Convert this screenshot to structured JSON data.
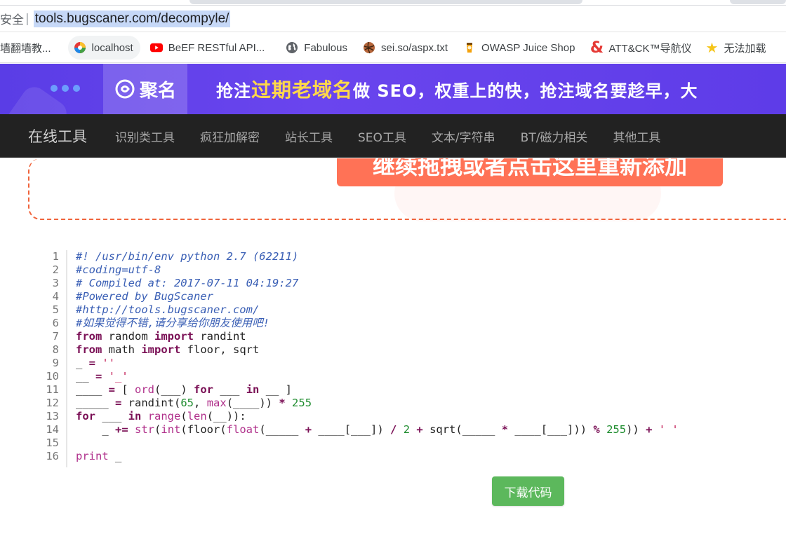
{
  "browser": {
    "security_label": "安全",
    "url": "tools.bugscaner.com/decompyle/"
  },
  "bookmarks": [
    {
      "label": "墙翻墙教...",
      "icon": "folder-icon"
    },
    {
      "label": "localhost",
      "icon": "chrome-pinwheel-icon"
    },
    {
      "label": "BeEF RESTful API...",
      "icon": "youtube-icon"
    },
    {
      "label": "Fabulous",
      "icon": "globe-icon"
    },
    {
      "label": "sei.so/aspx.txt",
      "icon": "ball-icon"
    },
    {
      "label": "OWASP Juice Shop",
      "icon": "juice-icon"
    },
    {
      "label": "ATT&CK™导航仪",
      "icon": "ampersand-icon"
    },
    {
      "label": "无法加载",
      "icon": "star-icon"
    }
  ],
  "banner": {
    "logo_text": "聚名",
    "slogan_prefix": "抢注",
    "slogan_highlight": "过期老域名",
    "slogan_suffix": "做 SEO，权重上的快，抢注域名要趁早，大"
  },
  "nav": {
    "brand": "在线工具",
    "items": [
      "识别类工具",
      "疯狂加解密",
      "站长工具",
      "SEO工具",
      "文本/字符串",
      "BT/磁力相关",
      "其他工具"
    ]
  },
  "upload": {
    "button_text": "继续拖拽或者点击这里重新添加"
  },
  "code": {
    "line_numbers": [
      "1",
      "2",
      "3",
      "4",
      "5",
      "6",
      "7",
      "8",
      "9",
      "10",
      "11",
      "12",
      "13",
      "14",
      "15",
      "16"
    ],
    "lines": [
      [
        {
          "t": "#! /usr/bin/env python 2.7 (62211)",
          "c": "com"
        }
      ],
      [
        {
          "t": "#coding=utf-8",
          "c": "com"
        }
      ],
      [
        {
          "t": "# Compiled at: 2017-07-11 04:19:27",
          "c": "com"
        }
      ],
      [
        {
          "t": "#Powered by BugScaner",
          "c": "com"
        }
      ],
      [
        {
          "t": "#http://tools.bugscaner.com/",
          "c": "com"
        }
      ],
      [
        {
          "t": "#如果觉得不错,请分享给你朋友使用吧!",
          "c": "com"
        }
      ],
      [
        {
          "t": "from",
          "c": "kw"
        },
        {
          "t": " random ",
          "c": "plain"
        },
        {
          "t": "import",
          "c": "kw"
        },
        {
          "t": " randint",
          "c": "plain"
        }
      ],
      [
        {
          "t": "from",
          "c": "kw"
        },
        {
          "t": " math ",
          "c": "plain"
        },
        {
          "t": "import",
          "c": "kw"
        },
        {
          "t": " floor, sqrt",
          "c": "plain"
        }
      ],
      [
        {
          "t": "_ ",
          "c": "plain"
        },
        {
          "t": "=",
          "c": "op"
        },
        {
          "t": " ",
          "c": "plain"
        },
        {
          "t": "''",
          "c": "str"
        }
      ],
      [
        {
          "t": "__ ",
          "c": "plain"
        },
        {
          "t": "=",
          "c": "op"
        },
        {
          "t": " ",
          "c": "plain"
        },
        {
          "t": "'_'",
          "c": "str"
        }
      ],
      [
        {
          "t": "____ ",
          "c": "plain"
        },
        {
          "t": "=",
          "c": "op"
        },
        {
          "t": " [ ",
          "c": "plain"
        },
        {
          "t": "ord",
          "c": "bi"
        },
        {
          "t": "(___) ",
          "c": "plain"
        },
        {
          "t": "for",
          "c": "kw"
        },
        {
          "t": " ___ ",
          "c": "plain"
        },
        {
          "t": "in",
          "c": "kw"
        },
        {
          "t": " __ ]",
          "c": "plain"
        }
      ],
      [
        {
          "t": "_____ ",
          "c": "plain"
        },
        {
          "t": "=",
          "c": "op"
        },
        {
          "t": " randint(",
          "c": "plain"
        },
        {
          "t": "65",
          "c": "num"
        },
        {
          "t": ", ",
          "c": "plain"
        },
        {
          "t": "max",
          "c": "bi"
        },
        {
          "t": "(____)) ",
          "c": "plain"
        },
        {
          "t": "*",
          "c": "op"
        },
        {
          "t": " ",
          "c": "plain"
        },
        {
          "t": "255",
          "c": "num"
        }
      ],
      [
        {
          "t": "for",
          "c": "kw"
        },
        {
          "t": " ___ ",
          "c": "plain"
        },
        {
          "t": "in",
          "c": "kw"
        },
        {
          "t": " ",
          "c": "plain"
        },
        {
          "t": "range",
          "c": "bi"
        },
        {
          "t": "(",
          "c": "plain"
        },
        {
          "t": "len",
          "c": "bi"
        },
        {
          "t": "(__)):",
          "c": "plain"
        }
      ],
      [
        {
          "t": "    _ ",
          "c": "plain"
        },
        {
          "t": "+=",
          "c": "op"
        },
        {
          "t": " ",
          "c": "plain"
        },
        {
          "t": "str",
          "c": "bi"
        },
        {
          "t": "(",
          "c": "plain"
        },
        {
          "t": "int",
          "c": "bi"
        },
        {
          "t": "(floor(",
          "c": "plain"
        },
        {
          "t": "float",
          "c": "bi"
        },
        {
          "t": "(_____ ",
          "c": "plain"
        },
        {
          "t": "+",
          "c": "op"
        },
        {
          "t": " ____[___]) ",
          "c": "plain"
        },
        {
          "t": "/",
          "c": "op"
        },
        {
          "t": " ",
          "c": "plain"
        },
        {
          "t": "2",
          "c": "num"
        },
        {
          "t": " ",
          "c": "plain"
        },
        {
          "t": "+",
          "c": "op"
        },
        {
          "t": " sqrt(_____ ",
          "c": "plain"
        },
        {
          "t": "*",
          "c": "op"
        },
        {
          "t": " ____[___])) ",
          "c": "plain"
        },
        {
          "t": "%",
          "c": "op"
        },
        {
          "t": " ",
          "c": "plain"
        },
        {
          "t": "255",
          "c": "num"
        },
        {
          "t": ")) ",
          "c": "plain"
        },
        {
          "t": "+",
          "c": "op"
        },
        {
          "t": " ",
          "c": "plain"
        },
        {
          "t": "' '",
          "c": "str"
        }
      ],
      [],
      [
        {
          "t": "print",
          "c": "bi"
        },
        {
          "t": " _",
          "c": "plain"
        }
      ]
    ]
  },
  "download": {
    "label": "下载代码"
  }
}
